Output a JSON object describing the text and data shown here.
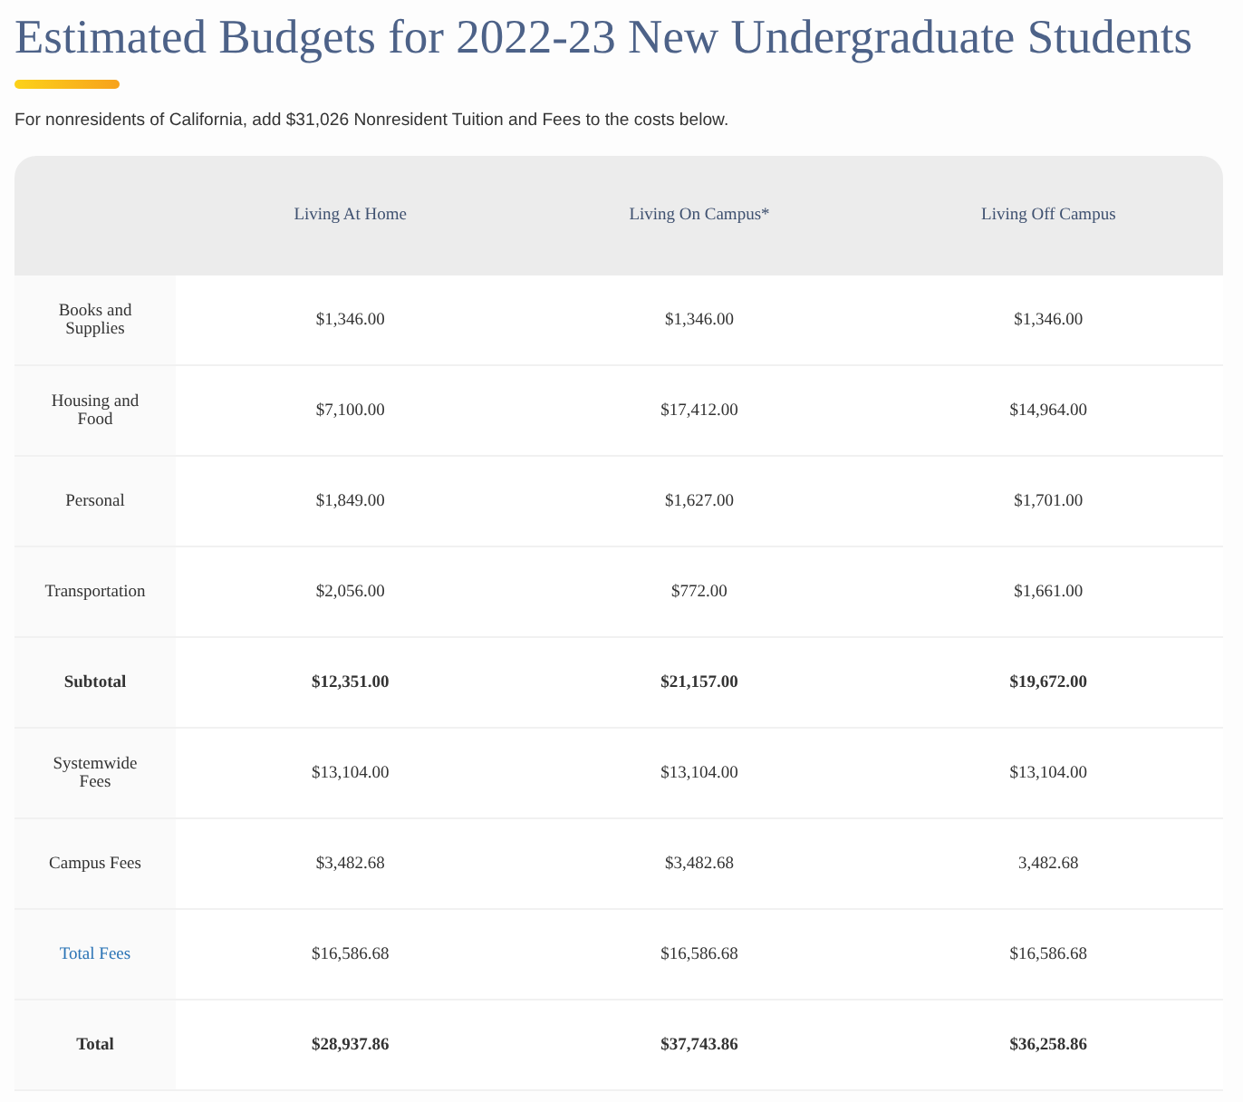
{
  "title": "Estimated Budgets for 2022-23 New Undergraduate Students",
  "note": "For nonresidents of California, add $31,026 Nonresident Tuition and Fees to the costs below.",
  "table": {
    "columns": [
      "Living At Home",
      "Living On Campus*",
      "Living Off Campus"
    ],
    "rows": [
      {
        "label": "Books and Supplies",
        "kind": "item",
        "cells": [
          "$1,346.00",
          "$1,346.00",
          "$1,346.00"
        ]
      },
      {
        "label": "Housing and Food",
        "kind": "item",
        "cells": [
          "$7,100.00",
          "$17,412.00",
          "$14,964.00"
        ]
      },
      {
        "label": "Personal",
        "kind": "item",
        "cells": [
          "$1,849.00",
          "$1,627.00",
          "$1,701.00"
        ]
      },
      {
        "label": "Transportation",
        "kind": "item",
        "cells": [
          "$2,056.00",
          "$772.00",
          "$1,661.00"
        ]
      },
      {
        "label": "Subtotal",
        "kind": "total",
        "cells": [
          "$12,351.00",
          "$21,157.00",
          "$19,672.00"
        ]
      },
      {
        "label": "Systemwide Fees",
        "kind": "item",
        "cells": [
          "$13,104.00",
          "$13,104.00",
          "$13,104.00"
        ]
      },
      {
        "label": "Campus Fees",
        "kind": "item",
        "cells": [
          "$3,482.68",
          "$3,482.68",
          "3,482.68"
        ]
      },
      {
        "label": "Total Fees",
        "kind": "link",
        "cells": [
          "$16,586.68",
          "$16,586.68",
          "$16,586.68"
        ]
      },
      {
        "label": "Total",
        "kind": "total",
        "cells": [
          "$28,937.86",
          "$37,743.86",
          "$36,258.86"
        ]
      }
    ]
  }
}
